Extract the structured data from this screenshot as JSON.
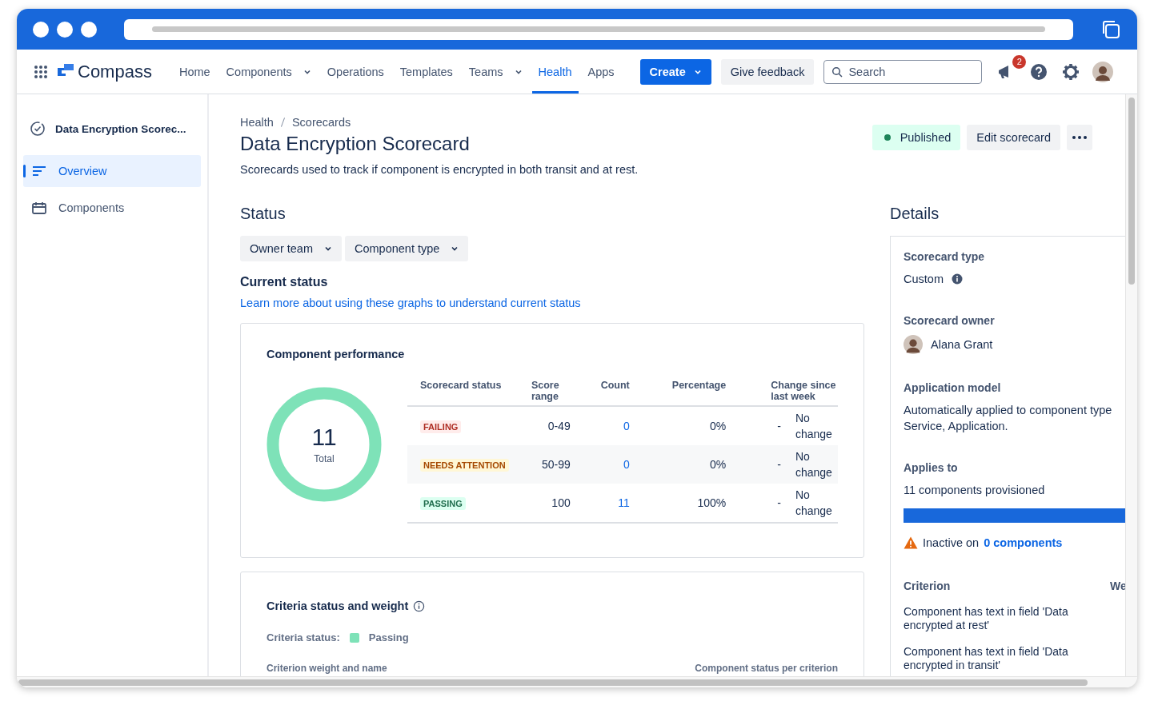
{
  "nav": {
    "product": "Compass",
    "items": [
      {
        "label": "Home",
        "dropdown": false,
        "selected": false
      },
      {
        "label": "Components",
        "dropdown": true,
        "selected": false
      },
      {
        "label": "Operations",
        "dropdown": false,
        "selected": false
      },
      {
        "label": "Templates",
        "dropdown": false,
        "selected": false
      },
      {
        "label": "Teams",
        "dropdown": true,
        "selected": false
      },
      {
        "label": "Health",
        "dropdown": false,
        "selected": true
      },
      {
        "label": "Apps",
        "dropdown": false,
        "selected": false
      }
    ],
    "create": "Create",
    "feedback": "Give feedback",
    "search": {
      "placeholder": "Search"
    },
    "notification_count": "2"
  },
  "sidebar": {
    "title": "Data Encryption Scorec...",
    "items": [
      {
        "label": "Overview",
        "selected": true
      },
      {
        "label": "Components",
        "selected": false
      }
    ]
  },
  "breadcrumbs": [
    "Health",
    "Scorecards"
  ],
  "title": "Data Encryption Scorecard",
  "description": "Scorecards used to track if component is encrypted in both transit and at rest.",
  "status_badge": "Published",
  "edit_button": "Edit scorecard",
  "status": {
    "heading": "Status",
    "filters": [
      "Owner team",
      "Component type"
    ],
    "current_heading": "Current status",
    "link": "Learn more about using these graphs to understand current status"
  },
  "performance": {
    "title": "Component performance",
    "total": "11",
    "total_label": "Total",
    "columns": [
      "Scorecard status",
      "Score range",
      "Count",
      "Percentage",
      "Change since last week"
    ],
    "rows": [
      {
        "status": "FAILING",
        "kind": "failing",
        "range": "0-49",
        "count": "0",
        "percentage": "0%",
        "trend": "-",
        "change": "No change"
      },
      {
        "status": "NEEDS ATTENTION",
        "kind": "attention",
        "range": "50-99",
        "count": "0",
        "percentage": "0%",
        "trend": "-",
        "change": "No change"
      },
      {
        "status": "PASSING",
        "kind": "passing",
        "range": "100",
        "count": "11",
        "percentage": "100%",
        "trend": "-",
        "change": "No change"
      }
    ]
  },
  "criteria": {
    "title": "Criteria status and weight",
    "status_label": "Criteria status:",
    "status_value": "Passing",
    "column_1": "Criterion weight and name",
    "column_2": "Component status per criterion"
  },
  "details": {
    "heading": "Details",
    "type_label": "Scorecard type",
    "type_value": "Custom",
    "owner_label": "Scorecard owner",
    "owner_name": "Alana Grant",
    "model_label": "Application model",
    "model_value": "Automatically applied to component type Service, Application.",
    "applies_label": "Applies to",
    "applies_value": "11 components provisioned",
    "level": 1,
    "inactive_text": "Inactive on",
    "inactive_link": "0 components",
    "criterion_heading": "Criterion",
    "weight_heading": "We",
    "criteria": [
      "Component has text in field 'Data encrypted at rest'",
      "Component has text in field 'Data encrypted in transit'"
    ]
  }
}
